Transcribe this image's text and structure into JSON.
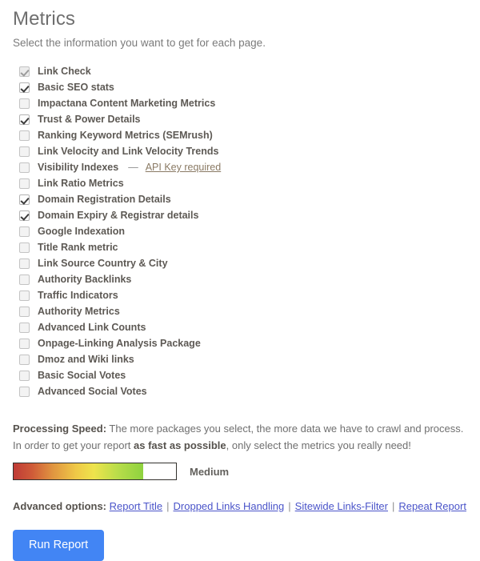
{
  "header": {
    "title": "Metrics",
    "subtitle": "Select the information you want to get for each page."
  },
  "metrics": [
    {
      "label": "Link Check",
      "state": "disabled"
    },
    {
      "label": "Basic SEO stats",
      "state": "checked"
    },
    {
      "label": "Impactana Content Marketing Metrics",
      "state": "empty"
    },
    {
      "label": "Trust & Power Details",
      "state": "checked"
    },
    {
      "label": "Ranking Keyword Metrics (SEMrush)",
      "state": "empty"
    },
    {
      "label": "Link Velocity and Link Velocity Trends",
      "state": "empty"
    },
    {
      "label": "Visibility Indexes",
      "state": "empty",
      "dash": "—",
      "note": "API Key required"
    },
    {
      "label": "Link Ratio Metrics",
      "state": "empty"
    },
    {
      "label": "Domain Registration Details",
      "state": "checked"
    },
    {
      "label": "Domain Expiry & Registrar details",
      "state": "checked"
    },
    {
      "label": "Google Indexation",
      "state": "empty"
    },
    {
      "label": "Title Rank metric",
      "state": "empty"
    },
    {
      "label": "Link Source Country & City",
      "state": "empty"
    },
    {
      "label": "Authority Backlinks",
      "state": "empty"
    },
    {
      "label": "Traffic Indicators",
      "state": "empty"
    },
    {
      "label": "Authority Metrics",
      "state": "empty"
    },
    {
      "label": "Advanced Link Counts",
      "state": "empty"
    },
    {
      "label": "Onpage-Linking Analysis Package",
      "state": "empty"
    },
    {
      "label": "Dmoz and Wiki links",
      "state": "empty"
    },
    {
      "label": "Basic Social Votes",
      "state": "empty"
    },
    {
      "label": "Advanced Social Votes",
      "state": "empty"
    }
  ],
  "speed": {
    "line1_label": "Processing Speed:",
    "line1_text": " The more packages you select, the more data we have to crawl and process.",
    "line2_pre": "In order to get your report ",
    "line2_bold": "as fast as possible",
    "line2_post": ", only select the metrics you really need!",
    "value": "Medium",
    "fill_percent": 80
  },
  "advanced": {
    "label": "Advanced options:",
    "separator": "|",
    "links": [
      "Report Title",
      "Dropped Links Handling",
      "Sitewide Links-Filter",
      "Repeat Report"
    ]
  },
  "actions": {
    "run_label": "Run Report"
  }
}
